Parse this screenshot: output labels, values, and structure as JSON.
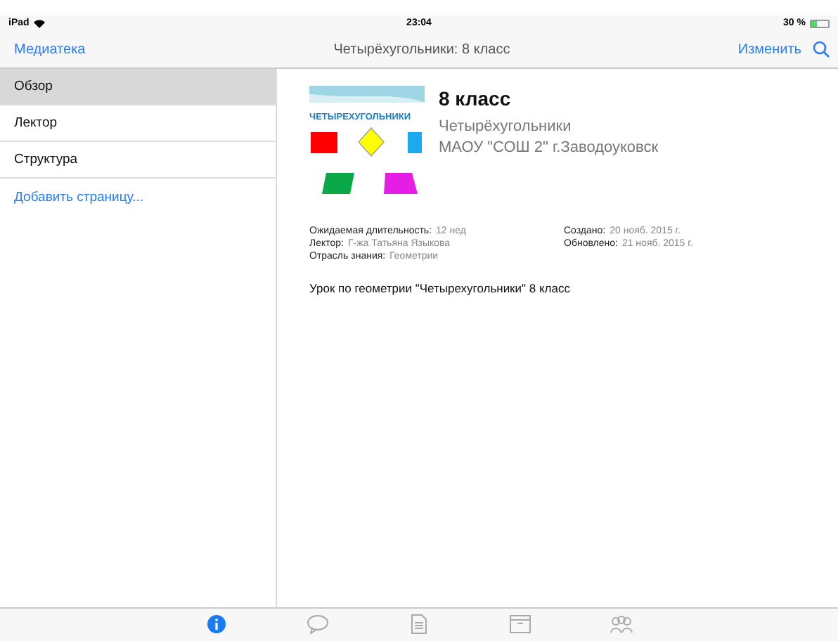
{
  "status_bar": {
    "device": "iPad",
    "time": "23:04",
    "battery": "30 %"
  },
  "nav_bar": {
    "back": "Медиатека",
    "title": "Четырёхугольники: 8 класс",
    "edit": "Изменить"
  },
  "sidebar": {
    "items": [
      {
        "label": "Обзор",
        "selected": true
      },
      {
        "label": "Лектор",
        "selected": false
      },
      {
        "label": "Структура",
        "selected": false
      }
    ],
    "add": "Добавить страницу..."
  },
  "course": {
    "thumbnail_caption": "ЧЕТЫРЕХУГОЛЬНИКИ",
    "title": "8 класс",
    "subtitle": "Четырёхугольники",
    "school": "МАОУ \"СОШ 2\" г.Заводоуковск",
    "details_left": [
      {
        "label": "Ожидаемая длительность:",
        "value": "12 нед"
      },
      {
        "label": "Лектор:",
        "value": "Г-жа Татьяна Языкова"
      },
      {
        "label": "Отрасль знания:",
        "value": "Геометрии"
      }
    ],
    "details_right": [
      {
        "label": "Создано:",
        "value": "20 нояб. 2015 г."
      },
      {
        "label": "Обновлено:",
        "value": "21 нояб. 2015 г."
      }
    ],
    "description": "Урок по геометрии \"Четырехугольники\" 8 класс"
  },
  "tab_bar": [
    {
      "kind": "info",
      "selected": true
    },
    {
      "kind": "bubble",
      "selected": false
    },
    {
      "kind": "document",
      "selected": false
    },
    {
      "kind": "box",
      "selected": false
    },
    {
      "kind": "people",
      "selected": false
    }
  ]
}
